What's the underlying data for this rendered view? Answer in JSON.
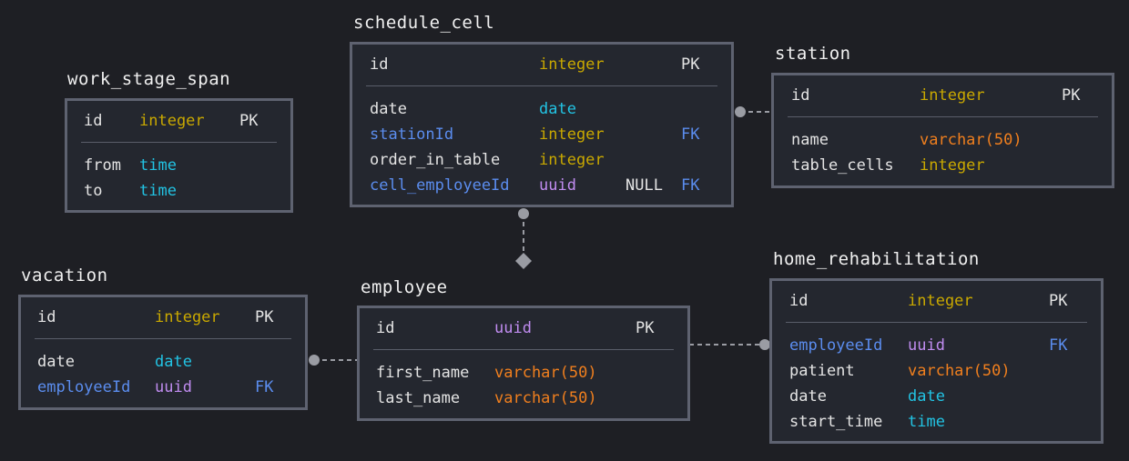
{
  "colors": {
    "background": "#1e1f24",
    "table": "#24272f",
    "border": "#5e6270",
    "fk": "#5b8def",
    "integer": "#c9a800",
    "date": "#22c3e3",
    "uuid": "#c08cf0",
    "varchar": "#f07f1e"
  },
  "tables": [
    {
      "name": "work_stage_span",
      "pk": {
        "name": "id",
        "type": "integer",
        "key": "PK"
      },
      "fields": [
        {
          "name": "from",
          "type": "time"
        },
        {
          "name": "to",
          "type": "time"
        }
      ]
    },
    {
      "name": "schedule_cell",
      "pk": {
        "name": "id",
        "type": "integer",
        "key": "PK"
      },
      "fields": [
        {
          "name": "date",
          "type": "date"
        },
        {
          "name": "stationId",
          "type": "integer",
          "key": "FK"
        },
        {
          "name": "order_in_table",
          "type": "integer"
        },
        {
          "name": "cell_employeeId",
          "type": "uuid",
          "null": "NULL",
          "key": "FK"
        }
      ]
    },
    {
      "name": "station",
      "pk": {
        "name": "id",
        "type": "integer",
        "key": "PK"
      },
      "fields": [
        {
          "name": "name",
          "type": "varchar(50)"
        },
        {
          "name": "table_cells",
          "type": "integer"
        }
      ]
    },
    {
      "name": "vacation",
      "pk": {
        "name": "id",
        "type": "integer",
        "key": "PK"
      },
      "fields": [
        {
          "name": "date",
          "type": "date"
        },
        {
          "name": "employeeId",
          "type": "uuid",
          "key": "FK"
        }
      ]
    },
    {
      "name": "employee",
      "pk": {
        "name": "id",
        "type": "uuid",
        "key": "PK"
      },
      "fields": [
        {
          "name": "first_name",
          "type": "varchar(50)"
        },
        {
          "name": "last_name",
          "type": "varchar(50)"
        }
      ]
    },
    {
      "name": "home_rehabilitation",
      "pk": {
        "name": "id",
        "type": "integer",
        "key": "PK"
      },
      "fields": [
        {
          "name": "employeeId",
          "type": "uuid",
          "key": "FK"
        },
        {
          "name": "patient",
          "type": "varchar(50)"
        },
        {
          "name": "date",
          "type": "date"
        },
        {
          "name": "start_time",
          "type": "time"
        }
      ]
    }
  ]
}
